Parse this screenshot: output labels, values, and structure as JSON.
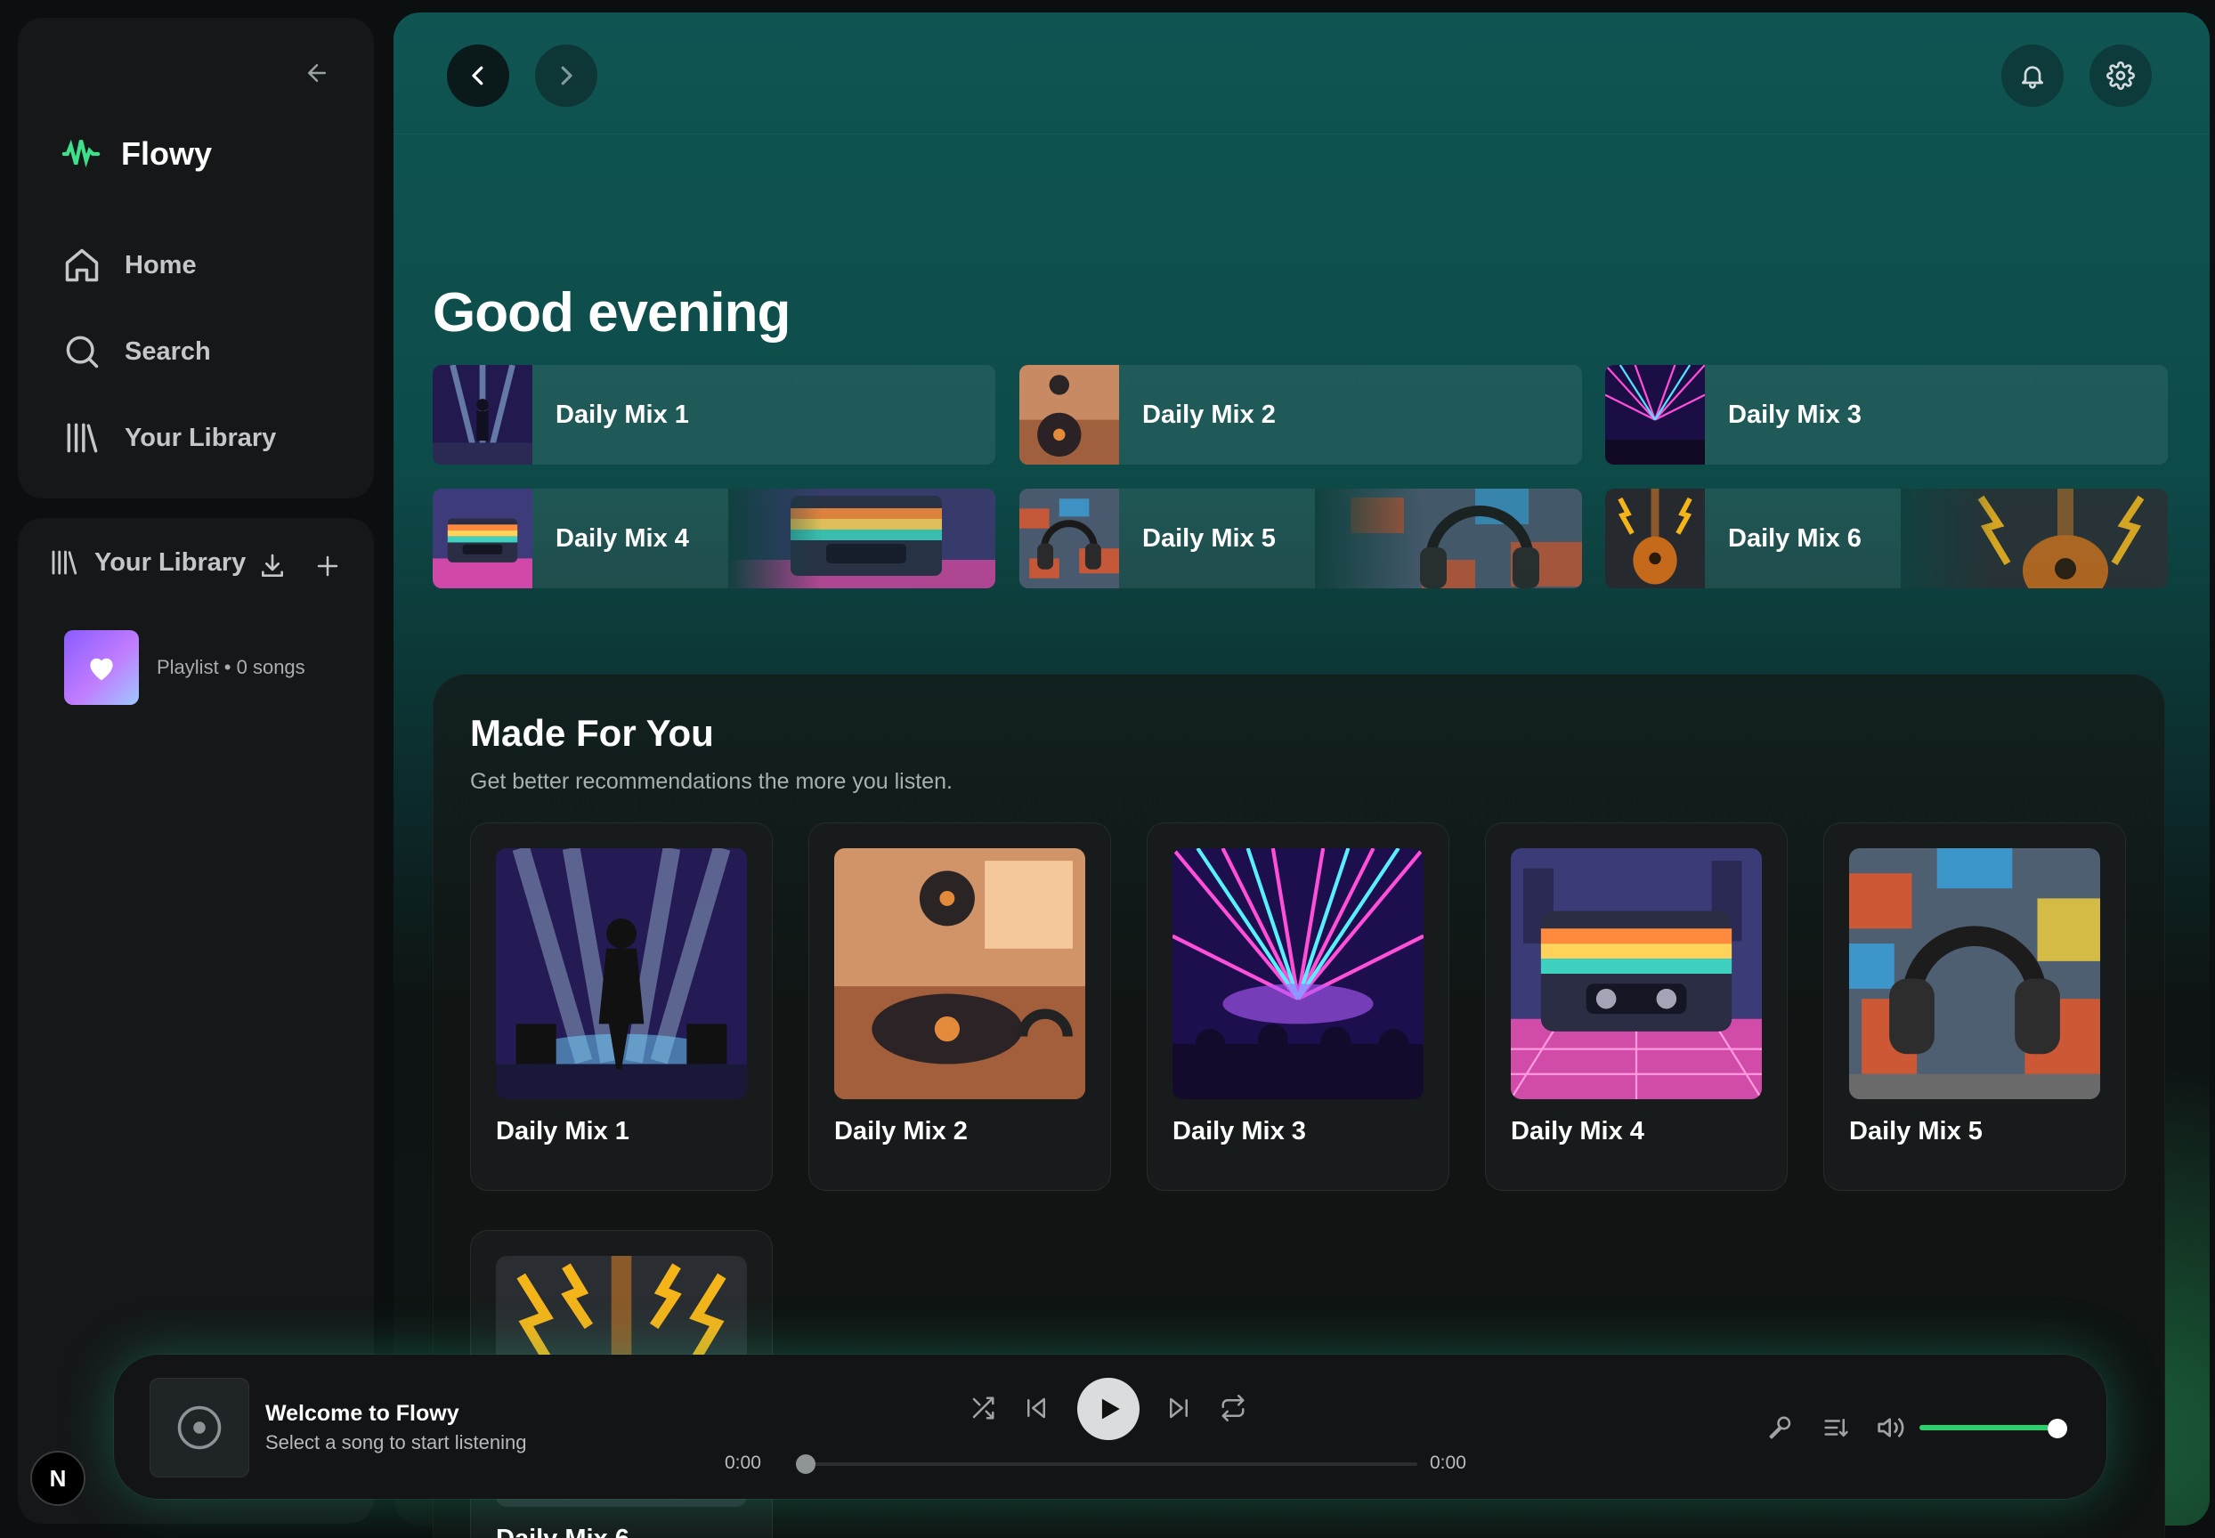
{
  "app": {
    "name": "Flowy"
  },
  "nav": {
    "items": [
      {
        "label": "Home",
        "icon": "home-icon"
      },
      {
        "label": "Search",
        "icon": "search-icon"
      },
      {
        "label": "Your Library",
        "icon": "library-icon"
      }
    ]
  },
  "library": {
    "title": "Your Library",
    "items": [
      {
        "subtitle": "Playlist • 0 songs",
        "icon": "heart-icon"
      }
    ]
  },
  "main": {
    "greeting": "Good evening",
    "quick_picks": [
      "Daily Mix 1",
      "Daily Mix 2",
      "Daily Mix 3",
      "Daily Mix 4",
      "Daily Mix 5",
      "Daily Mix 6"
    ],
    "made_for_you": {
      "title": "Made For You",
      "subtitle": "Get better recommendations the more you listen.",
      "cards": [
        "Daily Mix 1",
        "Daily Mix 2",
        "Daily Mix 3",
        "Daily Mix 4",
        "Daily Mix 5",
        "Daily Mix 6"
      ]
    }
  },
  "player": {
    "title": "Welcome to Flowy",
    "subtitle": "Select a song to start listening",
    "elapsed": "0:00",
    "duration": "0:00",
    "progress": 0,
    "volume": 0.92
  },
  "user": {
    "initial": "N"
  },
  "colors": {
    "accent": "#27d36a",
    "brand_icon": "#3ee08a",
    "background": "#0c0f10",
    "panel": "#151718"
  }
}
